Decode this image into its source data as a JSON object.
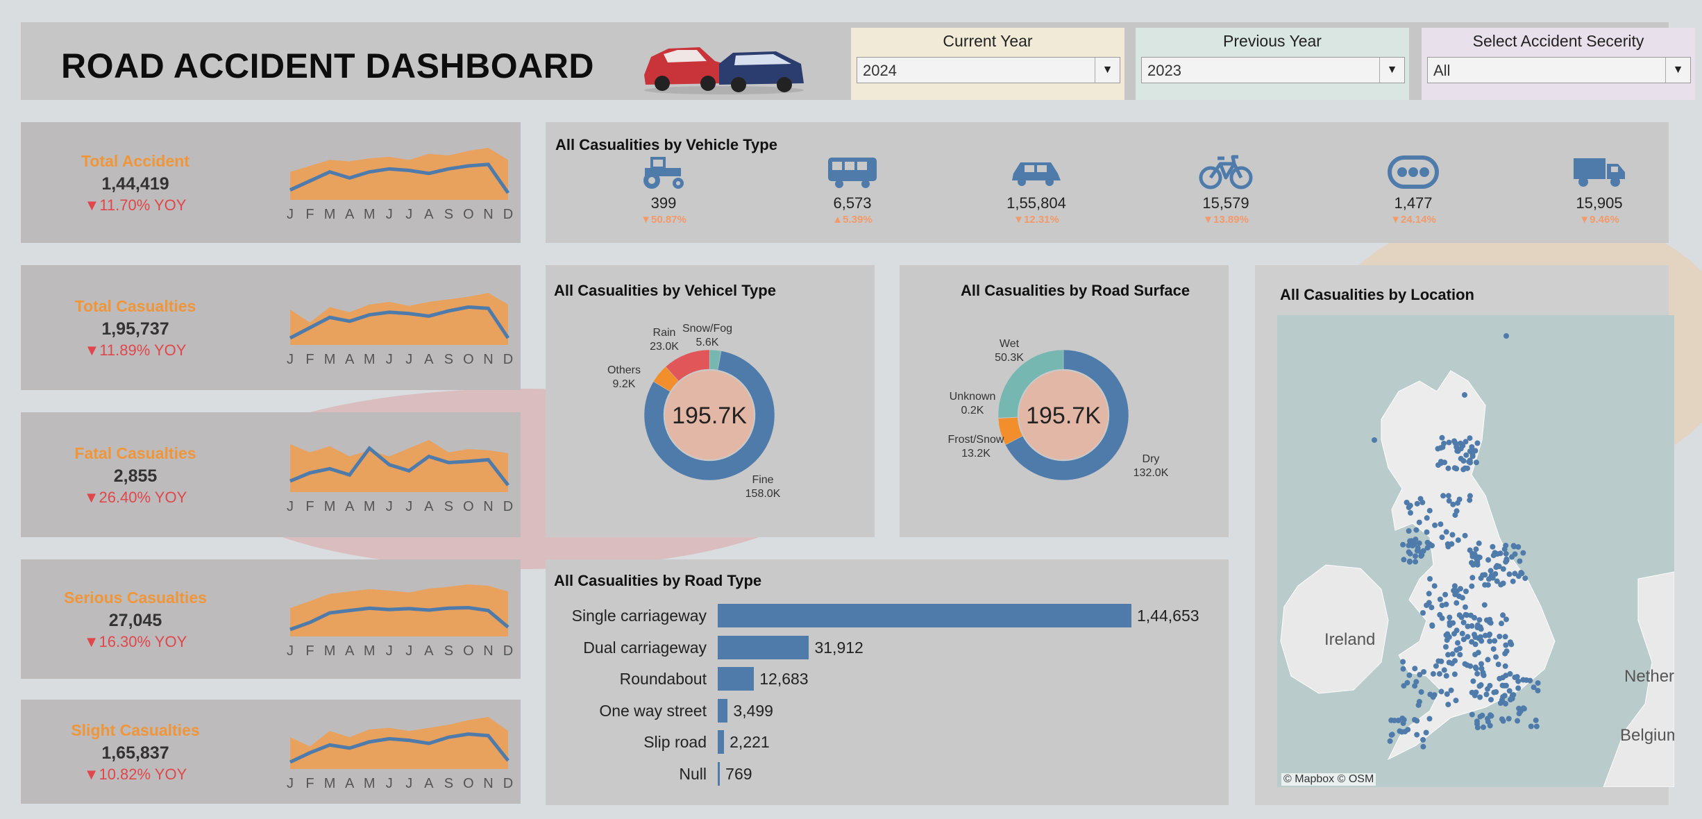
{
  "header": {
    "title": "ROAD ACCIDENT DASHBOARD",
    "filters": [
      {
        "label": "Current Year",
        "value": "2024"
      },
      {
        "label": "Previous Year",
        "value": "2023"
      },
      {
        "label": "Select Accident Secerity",
        "value": "All"
      }
    ]
  },
  "months": [
    "J",
    "F",
    "M",
    "A",
    "M",
    "J",
    "J",
    "A",
    "S",
    "O",
    "N",
    "D"
  ],
  "colors": {
    "accent": "#f0963a",
    "line": "#4f7bab",
    "negative": "#e0474c",
    "area": "#e9a15e"
  },
  "kpis": [
    {
      "name": "Total Accident",
      "value": "1,44,419",
      "yoy": "▼11.70% YOY",
      "current": [
        11.2,
        11.8,
        12.4,
        12.0,
        12.4,
        12.6,
        12.5,
        12.3,
        12.6,
        12.8,
        12.9,
        11.0
      ],
      "previous": [
        12.4,
        12.8,
        13.2,
        13.1,
        13.3,
        13.4,
        13.2,
        13.6,
        13.5,
        13.8,
        14.0,
        13.2
      ]
    },
    {
      "name": "Total Casualties",
      "value": "1,95,737",
      "yoy": "▼11.89% YOY",
      "current": [
        15.2,
        16.0,
        16.8,
        16.5,
        17.0,
        17.2,
        17.1,
        16.9,
        17.3,
        17.6,
        17.5,
        15.2
      ],
      "previous": [
        17.4,
        16.4,
        17.6,
        17.2,
        17.8,
        18.0,
        17.7,
        18.0,
        18.2,
        18.4,
        18.7,
        17.8
      ]
    },
    {
      "name": "Fatal Casualties",
      "value": "2,855",
      "yoy": "▼26.40% YOY",
      "current": [
        210,
        230,
        240,
        225,
        290,
        250,
        235,
        270,
        255,
        258,
        262,
        200
      ],
      "previous": [
        300,
        280,
        295,
        270,
        285,
        270,
        290,
        310,
        280,
        288,
        285,
        278
      ]
    },
    {
      "name": "Serious Casualties",
      "value": "27,045",
      "yoy": "▼16.30% YOY",
      "current": [
        2000,
        2150,
        2350,
        2400,
        2450,
        2420,
        2440,
        2410,
        2450,
        2460,
        2400,
        2050
      ],
      "previous": [
        2450,
        2600,
        2750,
        2800,
        2850,
        2820,
        2780,
        2860,
        2900,
        2950,
        2920,
        2800
      ]
    },
    {
      "name": "Slight Casualties",
      "value": "1,65,837",
      "yoy": "▼10.82%  YOY",
      "current": [
        13.0,
        13.6,
        14.1,
        13.9,
        14.3,
        14.5,
        14.4,
        14.2,
        14.6,
        14.8,
        14.7,
        13.1
      ],
      "previous": [
        14.6,
        14.0,
        15.0,
        14.6,
        15.1,
        15.2,
        15.0,
        15.2,
        15.4,
        15.7,
        15.9,
        15.0
      ]
    }
  ],
  "vehicle_panel": {
    "title": "All Casualities by Vehicle Type",
    "items": [
      {
        "icon": "tractor-icon",
        "value": "399",
        "yoy": "▼50.87%"
      },
      {
        "icon": "bus-icon",
        "value": "6,573",
        "yoy": "▲5.39%"
      },
      {
        "icon": "car-icon",
        "value": "1,55,804",
        "yoy": "▼12.31%"
      },
      {
        "icon": "bicycle-icon",
        "value": "15,579",
        "yoy": "▼13.89%"
      },
      {
        "icon": "other-vehicle-icon",
        "value": "1,477",
        "yoy": "▼24.14%"
      },
      {
        "icon": "truck-icon",
        "value": "15,905",
        "yoy": "▼9.46%"
      }
    ]
  },
  "donut_condition": {
    "title": "All  Casualities by Vehicel Type",
    "center": "195.7K",
    "slices": [
      {
        "name": "Fine",
        "label": "158.0K",
        "value": 158.0,
        "color": "#4f7bab"
      },
      {
        "name": "Others",
        "label": "9.2K",
        "value": 9.2,
        "color": "#f28e2b"
      },
      {
        "name": "Rain",
        "label": "23.0K",
        "value": 23.0,
        "color": "#e15759"
      },
      {
        "name": "Snow/Fog",
        "label": "5.6K",
        "value": 5.6,
        "color": "#76b7b2"
      }
    ]
  },
  "donut_surface": {
    "title": "All  Casualities by Road Surface",
    "center": "195.7K",
    "slices": [
      {
        "name": "Dry",
        "label": "132.0K",
        "value": 132.0,
        "color": "#4f7bab"
      },
      {
        "name": "Frost/Snow",
        "label": "13.2K",
        "value": 13.2,
        "color": "#f28e2b"
      },
      {
        "name": "Unknown",
        "label": "0.2K",
        "value": 0.2,
        "color": "#e15759"
      },
      {
        "name": "Wet",
        "label": "50.3K",
        "value": 50.3,
        "color": "#76b7b2"
      }
    ]
  },
  "chart_data": {
    "type": "bar",
    "title": "All Casualities by Road Type",
    "categories": [
      "Single carriageway",
      "Dual carriageway",
      "Roundabout",
      "One way street",
      "Slip road",
      "Null"
    ],
    "values": [
      144653,
      31912,
      12683,
      3499,
      2221,
      769
    ],
    "value_labels": [
      "1,44,653",
      "31,912",
      "12,683",
      "3,499",
      "2,221",
      "769"
    ],
    "orientation": "horizontal"
  },
  "map": {
    "title": "All Casualities by Location",
    "labels": [
      "Ireland",
      "Netherla",
      "Belgium"
    ],
    "attribution": "© Mapbox © OSM"
  }
}
